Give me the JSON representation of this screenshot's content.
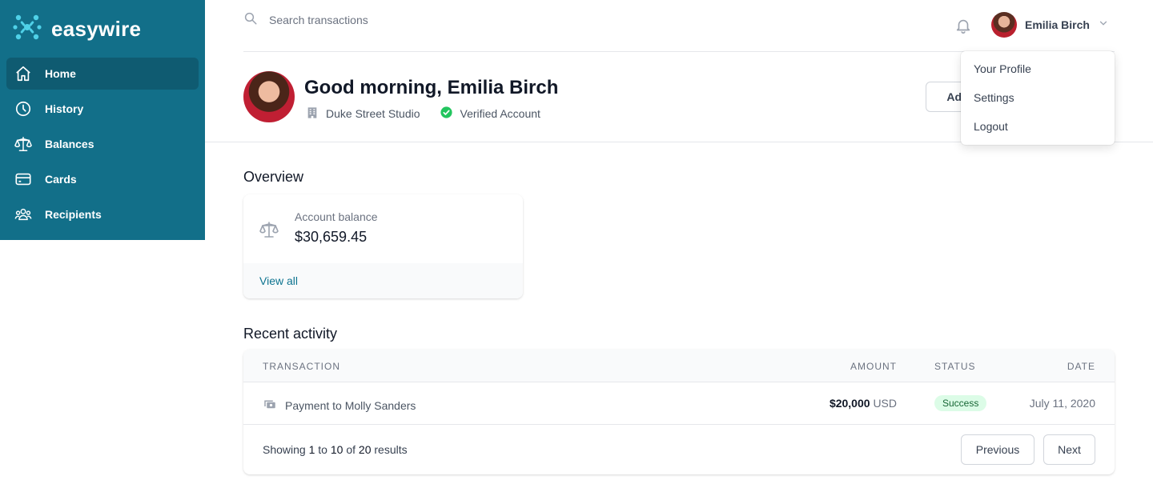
{
  "brand": {
    "name": "easywire"
  },
  "sidebar": {
    "items": [
      {
        "label": "Home",
        "icon": "home-icon",
        "active": true
      },
      {
        "label": "History",
        "icon": "clock-icon",
        "active": false
      },
      {
        "label": "Balances",
        "icon": "scale-icon",
        "active": false
      },
      {
        "label": "Cards",
        "icon": "credit-card-icon",
        "active": false
      },
      {
        "label": "Recipients",
        "icon": "user-group-icon",
        "active": false
      }
    ]
  },
  "topbar": {
    "search_placeholder": "Search transactions",
    "user_name": "Emilia Birch"
  },
  "dropdown": {
    "items": [
      "Your Profile",
      "Settings",
      "Logout"
    ]
  },
  "header": {
    "greeting": "Good morning, Emilia Birch",
    "company": "Duke Street Studio",
    "verified": "Verified Account",
    "add_button": "Add money"
  },
  "overview": {
    "title": "Overview",
    "card": {
      "label": "Account balance",
      "value": "$30,659.45",
      "link": "View all"
    }
  },
  "activity": {
    "title": "Recent activity",
    "columns": {
      "transaction": "TRANSACTION",
      "amount": "AMOUNT",
      "status": "STATUS",
      "date": "DATE"
    },
    "rows": [
      {
        "transaction": "Payment to Molly Sanders",
        "amount": "$20,000",
        "currency": "USD",
        "status": "Success",
        "date": "July 11, 2020"
      }
    ],
    "pagination": {
      "prefix": "Showing",
      "from": "1",
      "to_word": "to",
      "to": "10",
      "of_word": "of",
      "total": "20",
      "suffix": "results",
      "previous": "Previous",
      "next": "Next"
    }
  },
  "colors": {
    "sidebar": "#126f89",
    "sidebar_active": "#0f5b71",
    "accent": "#0e7490",
    "success_bg": "#dcfce7",
    "success_text": "#166534",
    "verified": "#22c55e"
  }
}
